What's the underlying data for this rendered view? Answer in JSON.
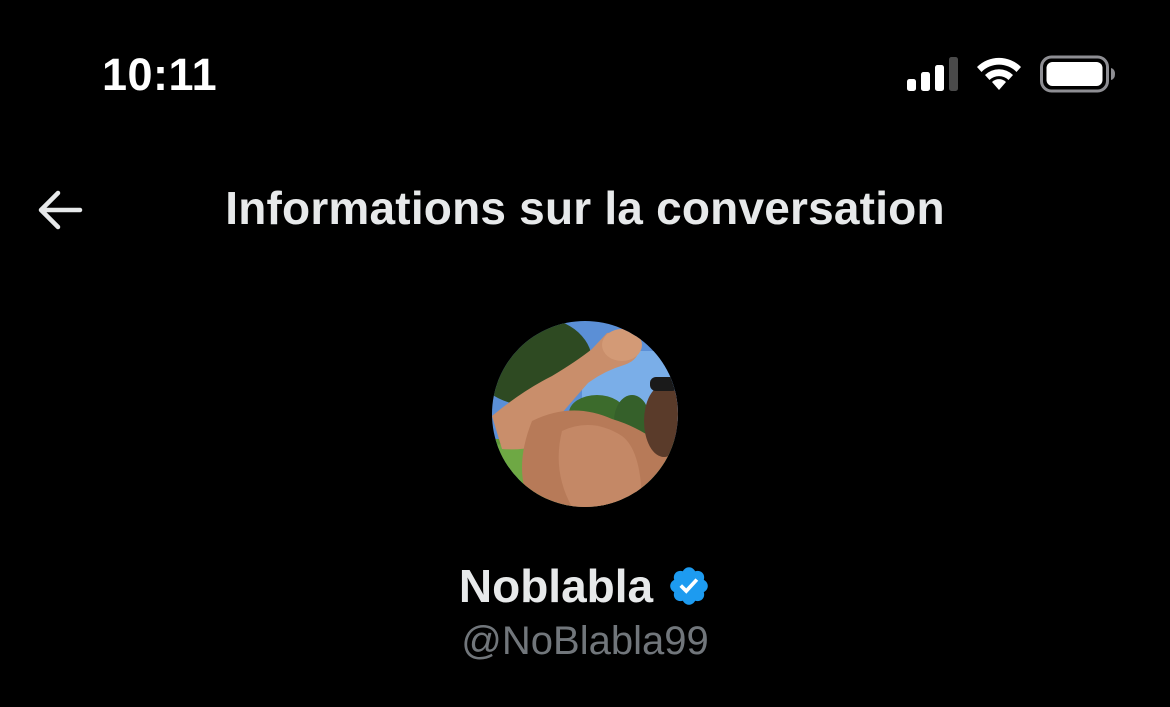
{
  "status_bar": {
    "time": "10:11",
    "icons": [
      "signal-icon",
      "wifi-icon",
      "battery-icon"
    ]
  },
  "header": {
    "back_icon": "arrow-left-icon",
    "title": "Informations sur la conversation"
  },
  "profile": {
    "display_name": "Noblabla",
    "verified": true,
    "verified_icon": "verified-badge-icon",
    "handle": "@NoBlabla99"
  },
  "colors": {
    "background": "#000000",
    "primary_text": "#e7e9ea",
    "secondary_text": "#71767b",
    "verified_blue": "#1d9bf0"
  }
}
